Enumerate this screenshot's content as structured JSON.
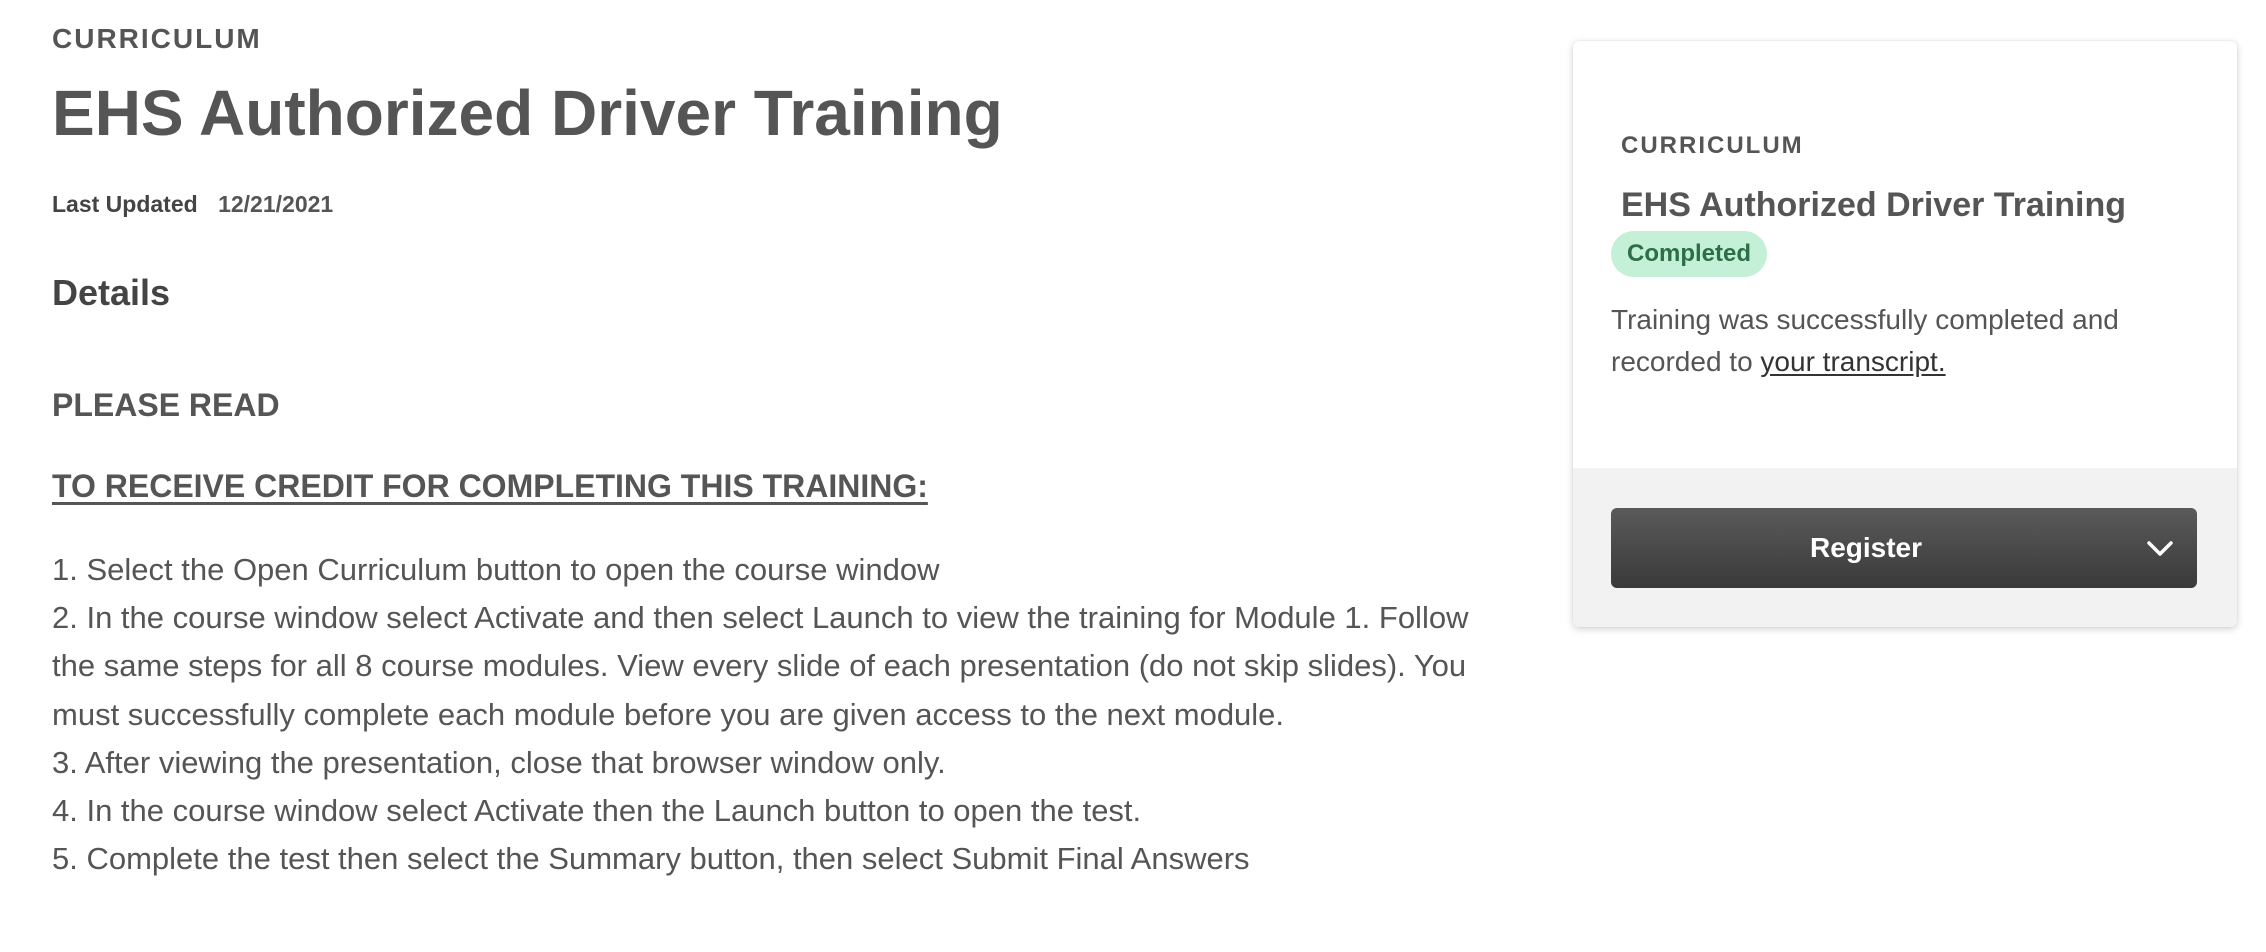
{
  "main": {
    "eyebrow": "CURRICULUM",
    "title": "EHS Authorized Driver Training",
    "last_updated_label": "Last Updated",
    "last_updated_value": "12/21/2021",
    "details_heading": "Details",
    "please_read": "PLEASE READ",
    "credit_heading": "TO RECEIVE CREDIT FOR COMPLETING THIS TRAINING:",
    "steps": [
      "1. Select the Open Curriculum button to open the course window",
      "2. In the course window select Activate and then select Launch to view the training for Module 1. Follow the same steps for all 8 course modules. View every slide of each presentation (do not skip slides). You must successfully complete each module before you are given access to the next module.",
      "3. After viewing the presentation, close that browser window only.",
      "4. In the course window select Activate then the Launch button to open the test.",
      "5. Complete the test then select the Summary button, then select Submit Final Answers"
    ]
  },
  "card": {
    "eyebrow": "CURRICULUM",
    "title": "EHS Authorized Driver Training",
    "status_badge": "Completed",
    "status_text": "Training was successfully completed and recorded to ",
    "transcript_link": "your transcript.",
    "register_label": "Register",
    "register_icon": "chevron-down-icon"
  },
  "colors": {
    "text": "#555555",
    "badge_bg": "#c3f0d6",
    "badge_text": "#2d6e47",
    "button_bg": "#444444",
    "footer_bg": "#f2f2f2"
  }
}
